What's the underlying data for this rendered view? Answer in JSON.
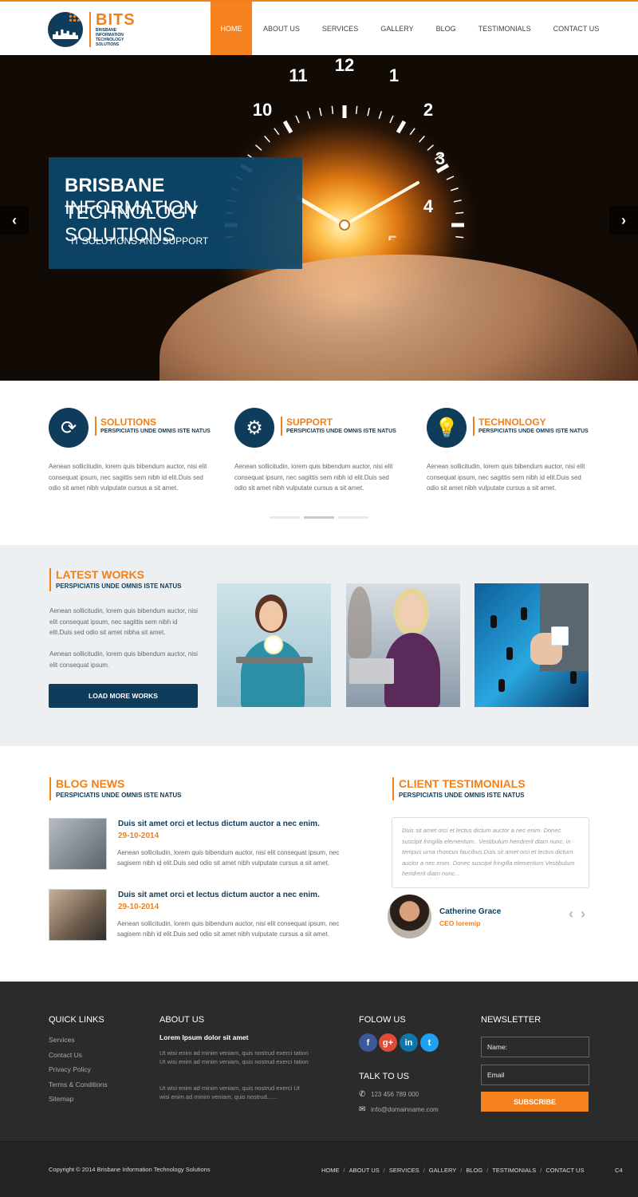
{
  "header": {
    "logo_name": "BITS",
    "logo_sub": "BRISBANE INFORMATION TECHNOLOGY SOLUTIONS",
    "nav": [
      "HOME",
      "ABOUT US",
      "SERVICES",
      "GALLERY",
      "BLOG",
      "TESTIMONIALS",
      "CONTACT US"
    ],
    "active_nav": "HOME"
  },
  "hero": {
    "title_bold": "BRISBANE",
    "title_rest": " INFORMATION",
    "title_line2": "TECHNOLOGY SOLUTIONS",
    "tagline": "IT SOLUTIONS AND SUPPORT",
    "clock_numbers": [
      "12",
      "1",
      "2",
      "3",
      "4",
      "5",
      "10",
      "11"
    ],
    "prev_arrow": "‹",
    "next_arrow": "›"
  },
  "services": [
    {
      "title": "SOLUTIONS",
      "subtitle": "PERSPICIATIS UNDE OMNIS ISTE NATUS",
      "icon": "refresh-globe-icon",
      "text": "Aenean sollicitudin, lorem quis bibendum auctor, nisi elit consequat ipsum, nec sagittis sem nibh id elit.Duis sed odio sit amet nibh vulputate cursus a sit amet."
    },
    {
      "title": "SUPPORT",
      "subtitle": "PERSPICIATIS UNDE OMNIS ISTE NATUS",
      "icon": "gear-icon",
      "text": "Aenean sollicitudin, lorem quis bibendum auctor, nisi elit consequat ipsum, nec sagittis sem nibh id elit.Duis sed odio sit amet nibh vulputate cursus a sit amet."
    },
    {
      "title": "TECHNOLOGY",
      "subtitle": "PERSPICIATIS UNDE OMNIS ISTE NATUS",
      "icon": "lightbulb-icon",
      "text": "Aenean sollicitudin, lorem quis bibendum auctor, nisi elit consequat ipsum, nec sagittis sem nibh id elit.Duis sed odio sit amet nibh vulputate cursus a sit amet."
    }
  ],
  "works": {
    "title": "LATEST WORKS",
    "subtitle": "PERSPICIATIS UNDE OMNIS ISTE NATUS",
    "p1": "Aenean sollicitudin, lorem quis bibendum auctor, nisi elit consequat ipsum, nec sagittis sem nibh id elit.Duis sed odio sit amet nibha sit amet.",
    "p2": "Aenean sollicitudin, lorem quis bibendum auctor, nisi elit consequat ipsum.",
    "button": "LOAD MORE WORKS"
  },
  "blog": {
    "title": "BLOG NEWS",
    "subtitle": "PERSPICIATIS UNDE OMNIS ISTE NATUS",
    "posts": [
      {
        "title": "Duis sit amet orci et lectus dictum auctor a nec enim.",
        "date": "29-10-2014",
        "text": "Aenean sollicitudin, lorem quis bibendum auctor, nisi elit consequat ipsum, nec sagisem nibh id elit.Duis sed odio sit amet nibh vulputate cursus a sit amet."
      },
      {
        "title": "Duis sit amet orci et lectus dictum auctor a nec enim.",
        "date": "29-10-2014",
        "text": "Aenean sollicitudin, lorem quis bibendum auctor, nisi elit consequat ipsum, nec sagisem nibh id elit.Duis sed odio sit amet nibh vulputate cursus a sit amet."
      }
    ]
  },
  "testimonials": {
    "title": "CLIENT TESTIMONIALS",
    "subtitle": "PERSPICIATIS UNDE OMNIS ISTE NATUS",
    "quote": "Duis sit amet orci et lectus dictum auctor a nec enim. Donec suscipit fringilla elementum.. Vestibulum hendrerit diam nunc, in tempus urna rhoncus faucibus.Duis sit amet orci et lectus dictum auctor a nec enim. Donec suscipit fringilla elementum Vestibulum hendrerit diam nunc...",
    "name": "Catherine Grace",
    "role": "CEO loremip",
    "prev": "‹",
    "next": "›"
  },
  "footer": {
    "quick_links_title": "QUICK LINKS",
    "quick_links": [
      "Services",
      "Contact Us",
      "Privacy Policy",
      "Terms & Conditions",
      "Sitemap"
    ],
    "about_title": "ABOUT US",
    "about_subtitle": "Lorem Ipsum dolor sit amet",
    "about_p1": "Ut wisi enim ad minim veniam, quis nostrud exerci tation Ut wisi enim ad minim veniam, quis nostrud exerci tation",
    "about_p2": "Ut wisi enim ad minim veniam, quis nostrud exerci Ut wisi enim ad minim veniam, quis nostrud......",
    "follow_title": "FOLOW US",
    "social": [
      {
        "name": "facebook-icon",
        "glyph": "f",
        "color": "#3b5998"
      },
      {
        "name": "google-plus-icon",
        "glyph": "g+",
        "color": "#dd4b39"
      },
      {
        "name": "linkedin-icon",
        "glyph": "in",
        "color": "#0e76a8"
      },
      {
        "name": "twitter-icon",
        "glyph": "t",
        "color": "#1da1f2"
      }
    ],
    "talk_title": "TALK TO US",
    "phone": "123 456 789 000",
    "email": "info@domainname.com",
    "newsletter_title": "NEWSLETTER",
    "name_placeholder": "Name:",
    "email_placeholder": "Email",
    "subscribe": "SUBSCRIBE"
  },
  "bottom": {
    "copyright": "Copyright © 2014  Brisbane Information Technology Solutions",
    "nav": [
      "HOME",
      "ABOUT US",
      "SERVICES",
      "GALLERY",
      "BLOG",
      "TESTIMONIALS",
      "CONTACT US"
    ],
    "badge": "C4"
  },
  "colors": {
    "accent": "#f5821f",
    "brand": "#0e3c5a",
    "footer_bg": "#2b2b2b"
  }
}
